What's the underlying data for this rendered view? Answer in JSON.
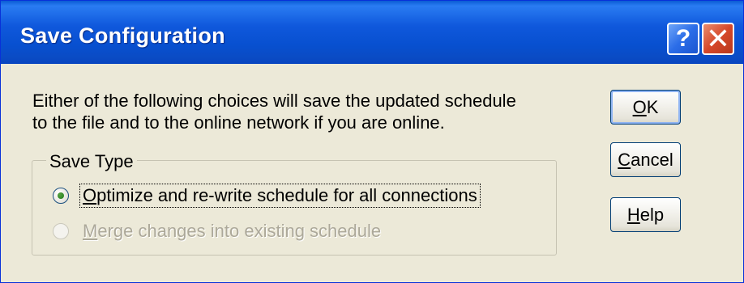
{
  "window": {
    "title": "Save Configuration",
    "help_button_label": "?",
    "close_button_label": "✕"
  },
  "message": {
    "line1": "Either of the following choices will save the updated schedule",
    "line2": "to the file and to the online network if you are online."
  },
  "save_type_group": {
    "label": "Save Type",
    "options": [
      {
        "mnemonic": "O",
        "rest": "ptimize and re-write schedule for all connections",
        "selected": true,
        "enabled": true
      },
      {
        "mnemonic": "M",
        "rest": "erge changes into existing schedule",
        "selected": false,
        "enabled": false
      }
    ]
  },
  "buttons": {
    "ok": {
      "mnemonic": "O",
      "rest": "K"
    },
    "cancel": {
      "mnemonic": "C",
      "rest": "ancel"
    },
    "help": {
      "mnemonic": "H",
      "rest": "elp"
    }
  },
  "colors": {
    "titlebar": "#0a5bd4",
    "window_face": "#ece9d8",
    "close_button": "#d6482a",
    "disabled_text": "#aca899"
  }
}
